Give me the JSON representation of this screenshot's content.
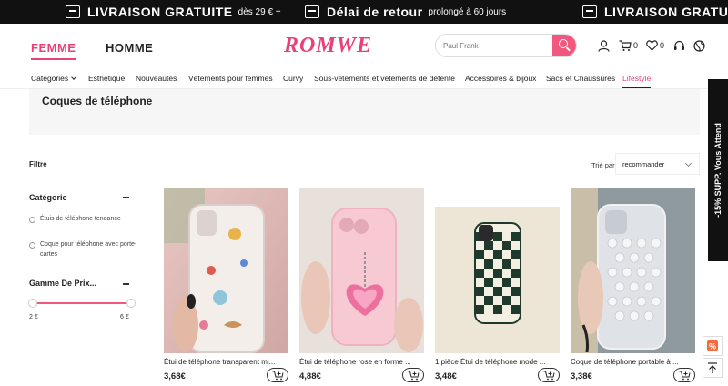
{
  "promo": {
    "items": [
      {
        "title": "LIVRAISON GRATUITE",
        "sub": "dès 29 € +"
      },
      {
        "title": "Délai de retour",
        "sub": "prolongé à 60 jours"
      },
      {
        "title": "LIVRAISON GRATUITE",
        "sub": ""
      }
    ]
  },
  "header": {
    "femme": "FEMME",
    "homme": "HOMME",
    "logo": "ROMWE",
    "search_placeholder": "Paul Frank",
    "cart_count": "0",
    "wishlist_count": "0"
  },
  "nav": {
    "items": [
      {
        "label": "Catégories"
      },
      {
        "label": "Esthétique"
      },
      {
        "label": "Nouveautés"
      },
      {
        "label": "Vêtements pour femmes"
      },
      {
        "label": "Curvy"
      },
      {
        "label": "Sous-vêtements et vêtements de détente"
      },
      {
        "label": "Accessoires & bijoux"
      },
      {
        "label": "Sacs et Chaussures"
      },
      {
        "label": "Lifestyle"
      }
    ]
  },
  "page": {
    "title": "Coques de téléphone"
  },
  "filter": {
    "label": "Filtre",
    "sort_label": "Trié par",
    "sort_value": "recommander",
    "category_title": "Catégorie",
    "category_options": [
      "Étuis de téléphone tendance",
      "Coque pour téléphone avec porte-cartes"
    ],
    "price_title": "Gamme De Prix...",
    "price_min": "2 €",
    "price_max": "6 €"
  },
  "products": [
    {
      "name": "Étui de téléphone transparent mi...",
      "price": "3,68€"
    },
    {
      "name": "Étui de téléphone rose en forme ...",
      "price": "4,88€"
    },
    {
      "name": "1 pièce Étui de téléphone mode ...",
      "price": "3,48€"
    },
    {
      "name": "Coque de téléphone portable à ...",
      "price": "3,38€"
    }
  ],
  "side_tab": {
    "label": "-15% SUPP. Vous Attend"
  },
  "colors": {
    "accent": "#e8407a",
    "search_button": "#f2577e",
    "promo_bg": "#111111"
  }
}
